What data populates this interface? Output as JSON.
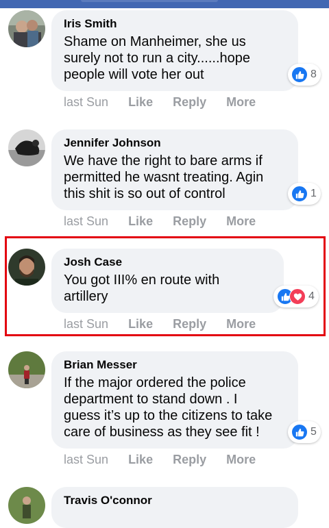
{
  "colors": {
    "header": "#4267b2",
    "bubble": "#f0f2f5",
    "like_blue": "#1877f2",
    "love_red": "#f33e58",
    "highlight_border": "#e3000f"
  },
  "comments": [
    {
      "author": "Iris Smith",
      "lines": [
        "Shame on Manheimer, she us",
        "surely not to run a city......hope",
        "people will vote her out"
      ],
      "reactions": [
        "like-icon"
      ],
      "reaction_count": "8",
      "time": "last Sun",
      "actions": {
        "like": "Like",
        "reply": "Reply",
        "more": "More"
      }
    },
    {
      "author": "Jennifer Johnson",
      "lines": [
        "We have the right to bare arms if",
        "permitted he wasnt treating. Agin",
        "this shit is so out of control"
      ],
      "reactions": [
        "like-icon"
      ],
      "reaction_count": "1",
      "time": "last Sun",
      "actions": {
        "like": "Like",
        "reply": "Reply",
        "more": "More"
      }
    },
    {
      "author": "Josh Case",
      "lines": [
        "You got III% en route with",
        "artillery"
      ],
      "reactions": [
        "like-icon",
        "love-icon"
      ],
      "reaction_count": "4",
      "time": "last Sun",
      "actions": {
        "like": "Like",
        "reply": "Reply",
        "more": "More"
      },
      "highlighted": true
    },
    {
      "author": "Brian Messer",
      "lines": [
        "If the major ordered the police",
        "department to stand down . I",
        "guess it’s up to the citizens to take",
        "care of business as they see fit !"
      ],
      "reactions": [
        "like-icon"
      ],
      "reaction_count": "5",
      "time": "last Sun",
      "actions": {
        "like": "Like",
        "reply": "Reply",
        "more": "More"
      }
    },
    {
      "author": "Travis O'connor",
      "lines": [],
      "reactions": [],
      "reaction_count": "",
      "time": "",
      "actions": {}
    }
  ]
}
